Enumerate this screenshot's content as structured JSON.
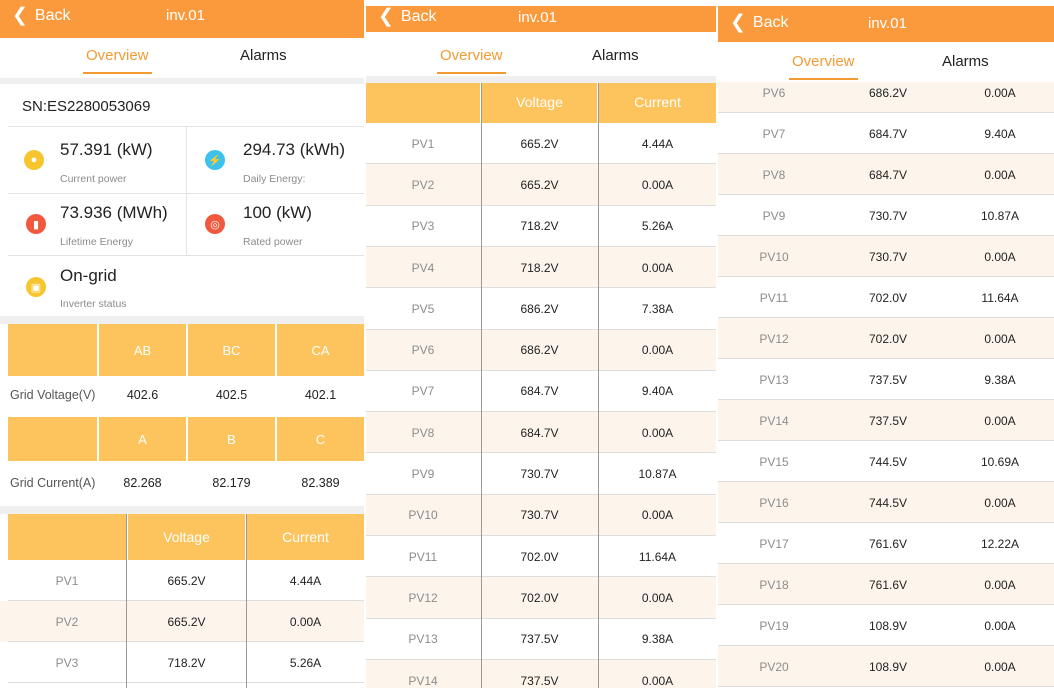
{
  "header": {
    "back_label": "Back",
    "title": "inv.01"
  },
  "tabs": {
    "overview": "Overview",
    "alarms": "Alarms"
  },
  "overview": {
    "sn": "SN:ES2280053069",
    "current_power": {
      "value": "57.391 (kW)",
      "label": "Current power",
      "icon": "power-icon",
      "color": "#f7c52d"
    },
    "daily_energy": {
      "value": "294.73 (kWh)",
      "label": "Daily Energy:",
      "icon": "bolt-icon",
      "color": "#3dc2ee"
    },
    "lifetime_energy": {
      "value": "73.936 (MWh)",
      "label": "Lifetime Energy",
      "icon": "battery-icon",
      "color": "#f0593d"
    },
    "rated_power": {
      "value": "100 (kW)",
      "label": "Rated power",
      "icon": "gauge-icon",
      "color": "#f0593d"
    },
    "inverter_status": {
      "value": "On-grid",
      "label": "Inverter status",
      "icon": "inverter-icon",
      "color": "#f7c52d"
    }
  },
  "grid_voltage": {
    "label": "Grid Voltage(V)",
    "headers": [
      "AB",
      "BC",
      "CA"
    ],
    "values": [
      "402.6",
      "402.5",
      "402.1"
    ]
  },
  "grid_current": {
    "label": "Grid Current(A)",
    "headers": [
      "A",
      "B",
      "C"
    ],
    "values": [
      "82.268",
      "82.179",
      "82.389"
    ]
  },
  "pv_table": {
    "headers": {
      "voltage": "Voltage",
      "current": "Current"
    },
    "rows": [
      {
        "name": "PV1",
        "voltage": "665.2V",
        "current": "4.44A"
      },
      {
        "name": "PV2",
        "voltage": "665.2V",
        "current": "0.00A"
      },
      {
        "name": "PV3",
        "voltage": "718.2V",
        "current": "5.26A"
      },
      {
        "name": "PV4",
        "voltage": "718.2V",
        "current": "0.00A"
      },
      {
        "name": "PV5",
        "voltage": "686.2V",
        "current": "7.38A"
      },
      {
        "name": "PV6",
        "voltage": "686.2V",
        "current": "0.00A"
      },
      {
        "name": "PV7",
        "voltage": "684.7V",
        "current": "9.40A"
      },
      {
        "name": "PV8",
        "voltage": "684.7V",
        "current": "0.00A"
      },
      {
        "name": "PV9",
        "voltage": "730.7V",
        "current": "10.87A"
      },
      {
        "name": "PV10",
        "voltage": "730.7V",
        "current": "0.00A"
      },
      {
        "name": "PV11",
        "voltage": "702.0V",
        "current": "11.64A"
      },
      {
        "name": "PV12",
        "voltage": "702.0V",
        "current": "0.00A"
      },
      {
        "name": "PV13",
        "voltage": "737.5V",
        "current": "9.38A"
      },
      {
        "name": "PV14",
        "voltage": "737.5V",
        "current": "0.00A"
      },
      {
        "name": "PV15",
        "voltage": "744.5V",
        "current": "10.69A"
      },
      {
        "name": "PV16",
        "voltage": "744.5V",
        "current": "0.00A"
      },
      {
        "name": "PV17",
        "voltage": "761.6V",
        "current": "12.22A"
      },
      {
        "name": "PV18",
        "voltage": "761.6V",
        "current": "0.00A"
      },
      {
        "name": "PV19",
        "voltage": "108.9V",
        "current": "0.00A"
      },
      {
        "name": "PV20",
        "voltage": "108.9V",
        "current": "0.00A"
      }
    ]
  },
  "colors": {
    "header_orange": "#fb9a3c",
    "table_header": "#fdc35d",
    "accent": "#f39b33",
    "row_alt": "#fdf5ec"
  }
}
